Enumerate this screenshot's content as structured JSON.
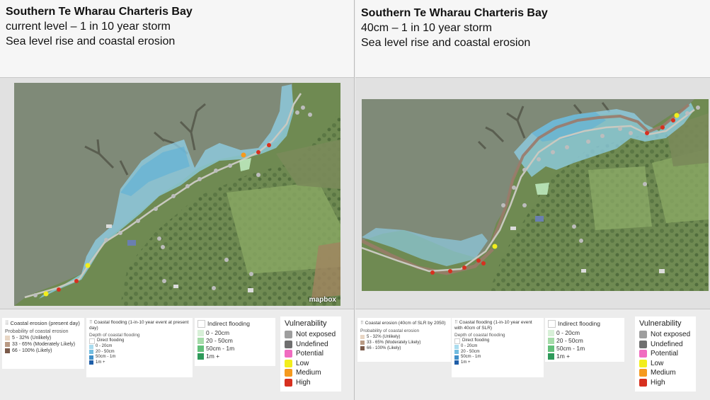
{
  "left": {
    "title": "Southern Te Wharau Charteris Bay",
    "subtitle": "current level – 1 in 10 year storm",
    "caption": "Sea level rise and coastal erosion",
    "erosion": {
      "title": "Coastal erosion (present day)",
      "prob_label": "Probability of coastal erosion",
      "items": [
        {
          "label": "5 - 32% (Unlikely)",
          "color": "#e8d6c4"
        },
        {
          "label": "33 - 65% (Moderately Likely)",
          "color": "#b99a84"
        },
        {
          "label": "66 - 100% (Likely)",
          "color": "#7a5a4a"
        }
      ]
    },
    "flooding": {
      "title": "Coastal flooding (1-in-10 year event at present day)",
      "depth_label": "Depth of coastal flooding",
      "items": [
        {
          "label": "Direct flooding",
          "color": "#ffffff"
        },
        {
          "label": "0 - 20cm",
          "color": "#a9dcef"
        },
        {
          "label": "20 - 50cm",
          "color": "#72bde0"
        },
        {
          "label": "50cm - 1m",
          "color": "#3f8fc8"
        },
        {
          "label": "1m +",
          "color": "#1f5ea8"
        }
      ]
    }
  },
  "right": {
    "title": "Southern Te Wharau Charteris Bay",
    "subtitle": "40cm – 1 in 10 year storm",
    "caption": "Sea level rise and coastal erosion",
    "erosion": {
      "title": "Coastal erosion (40cm of SLR by 2050)",
      "prob_label": "Probability of coastal erosion",
      "items": [
        {
          "label": "5 - 32% (Unlikely)",
          "color": "#e8d6c4"
        },
        {
          "label": "33 - 65% (Moderately Likely)",
          "color": "#b99a84"
        },
        {
          "label": "66 - 100% (Likely)",
          "color": "#7a5a4a"
        }
      ]
    },
    "flooding": {
      "title": "Coastal flooding (1-in-10 year event with 40cm of SLR)",
      "depth_label": "Depth of coastal flooding",
      "items": [
        {
          "label": "Direct flooding",
          "color": "#ffffff"
        },
        {
          "label": "0 - 20cm",
          "color": "#a9dcef"
        },
        {
          "label": "20 - 50cm",
          "color": "#72bde0"
        },
        {
          "label": "50cm - 1m",
          "color": "#3f8fc8"
        },
        {
          "label": "1m +",
          "color": "#1f5ea8"
        }
      ]
    }
  },
  "indirect": {
    "title": "Indirect flooding",
    "items": [
      {
        "label": "0 - 20cm",
        "color": "#d8f0d8"
      },
      {
        "label": "20 - 50cm",
        "color": "#a6dcaa"
      },
      {
        "label": "50cm - 1m",
        "color": "#62c07a"
      },
      {
        "label": "1m +",
        "color": "#2f9a5a"
      }
    ]
  },
  "vulnerability": {
    "title": "Vulnerability",
    "items": [
      {
        "label": "Not exposed",
        "color": "#9e9e9e"
      },
      {
        "label": "Undefined",
        "color": "#6f6f6f"
      },
      {
        "label": "Potential",
        "color": "#f06cc0"
      },
      {
        "label": "Low",
        "color": "#f2ee1c"
      },
      {
        "label": "Medium",
        "color": "#f59a1e"
      },
      {
        "label": "High",
        "color": "#d7301f"
      }
    ]
  },
  "mapbox_logo": "mapbox"
}
